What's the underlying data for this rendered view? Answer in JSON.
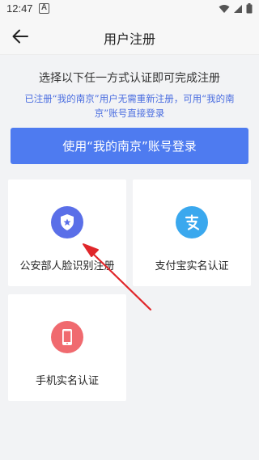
{
  "status_bar": {
    "time": "12:47",
    "alert_glyph": "A"
  },
  "header": {
    "title": "用户注册",
    "back_icon": "arrow-left-icon"
  },
  "instructions": {
    "main": "选择以下任一方式认证即可完成注册",
    "note": "已注册“我的南京”用户无需重新注册，可用“我的南京”账号直接登录"
  },
  "login_button": {
    "label": "使用“我的南京”账号登录"
  },
  "options": {
    "face": {
      "label": "公安部人脸识别注册",
      "icon": "shield-star-icon",
      "color": "#5a6fe8"
    },
    "alipay": {
      "label": "支付宝实名认证",
      "icon": "alipay-icon",
      "color": "#3aa8ee"
    },
    "phone": {
      "label": "手机实名认证",
      "icon": "phone-icon",
      "color": "#f06a6f"
    }
  },
  "colors": {
    "accent": "#4e7bf0",
    "note_text": "#4a6de0",
    "annotation": "#e0262a"
  }
}
